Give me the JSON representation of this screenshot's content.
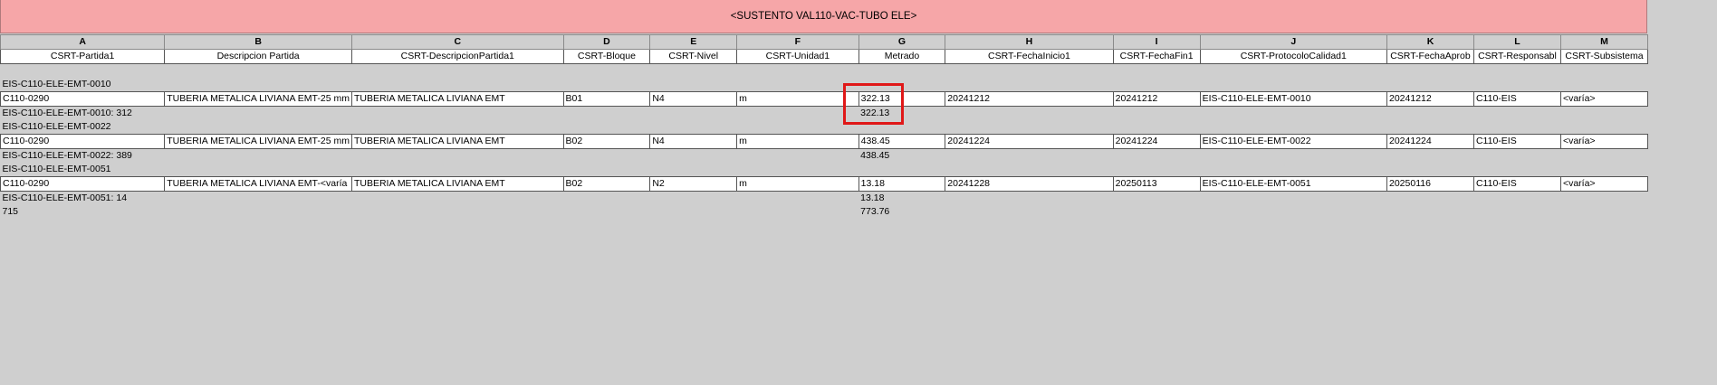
{
  "schedule": {
    "title": "<SUSTENTO VAL110-VAC-TUBO ELE>",
    "columns": [
      {
        "letter": "A",
        "header": "CSRT-Partida1"
      },
      {
        "letter": "B",
        "header": "Descripcion Partida"
      },
      {
        "letter": "C",
        "header": "CSRT-DescripcionPartida1"
      },
      {
        "letter": "D",
        "header": "CSRT-Bloque"
      },
      {
        "letter": "E",
        "header": "CSRT-Nivel"
      },
      {
        "letter": "F",
        "header": "CSRT-Unidad1"
      },
      {
        "letter": "G",
        "header": "Metrado"
      },
      {
        "letter": "H",
        "header": "CSRT-FechaInicio1"
      },
      {
        "letter": "I",
        "header": "CSRT-FechaFin1"
      },
      {
        "letter": "J",
        "header": "CSRT-ProtocoloCalidad1"
      },
      {
        "letter": "K",
        "header": "CSRT-FechaAprob"
      },
      {
        "letter": "L",
        "header": "CSRT-Responsabl"
      },
      {
        "letter": "M",
        "header": "CSRT-Subsistema"
      }
    ],
    "groups": [
      {
        "group_label": "EIS-C110-ELE-EMT-0010",
        "row": [
          "C110-0290",
          "TUBERIA METALICA LIVIANA EMT-25 mm",
          "TUBERIA METALICA LIVIANA EMT",
          "B01",
          "N4",
          "m",
          "322.13",
          "20241212",
          "20241212",
          "EIS-C110-ELE-EMT-0010",
          "20241212",
          "C110-EIS",
          "<varía>"
        ],
        "subtotal_label": "EIS-C110-ELE-EMT-0010: 312",
        "subtotal_value": "322.13"
      },
      {
        "group_label": "EIS-C110-ELE-EMT-0022",
        "row": [
          "C110-0290",
          "TUBERIA METALICA LIVIANA EMT-25 mm",
          "TUBERIA METALICA LIVIANA EMT",
          "B02",
          "N4",
          "m",
          "438.45",
          "20241224",
          "20241224",
          "EIS-C110-ELE-EMT-0022",
          "20241224",
          "C110-EIS",
          "<varía>"
        ],
        "subtotal_label": "EIS-C110-ELE-EMT-0022: 389",
        "subtotal_value": "438.45"
      },
      {
        "group_label": "EIS-C110-ELE-EMT-0051",
        "row": [
          "C110-0290",
          "TUBERIA METALICA LIVIANA EMT-<varía",
          "TUBERIA METALICA LIVIANA EMT",
          "B02",
          "N2",
          "m",
          "13.18",
          "20241228",
          "20250113",
          "EIS-C110-ELE-EMT-0051",
          "20250116",
          "C110-EIS",
          "<varía>"
        ],
        "subtotal_label": "EIS-C110-ELE-EMT-0051: 14",
        "subtotal_value": "13.18"
      }
    ],
    "grand_total_label": "715",
    "grand_total_value": "773.76"
  },
  "highlight_color": "#e01818",
  "title_bar_color": "#f6a6a8"
}
